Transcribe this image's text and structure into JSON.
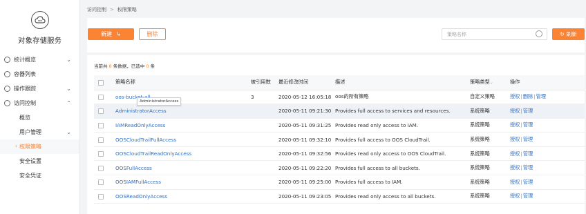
{
  "app": {
    "title": "对象存储服务"
  },
  "sidebar": {
    "items": [
      {
        "label": "统计概览",
        "icon": "chart-icon",
        "chevron": "⌄"
      },
      {
        "label": "容器列表",
        "icon": "bucket-icon",
        "chevron": ""
      },
      {
        "label": "操作跟踪",
        "icon": "track-icon",
        "chevron": "⌄"
      },
      {
        "label": "访问控制",
        "icon": "lock-icon",
        "chevron": "⌃"
      }
    ],
    "subitems": [
      {
        "label": "概览",
        "active": false,
        "chevron": ""
      },
      {
        "label": "用户管理",
        "active": false,
        "chevron": "⌄"
      },
      {
        "label": "权限策略",
        "active": true,
        "chevron": ""
      },
      {
        "label": "安全设置",
        "active": false,
        "chevron": ""
      },
      {
        "label": "安全凭证",
        "active": false,
        "chevron": ""
      }
    ]
  },
  "breadcrumb": {
    "parent": "访问控制",
    "current": "权限策略",
    "separator": ">"
  },
  "toolbar": {
    "new_label": "新建",
    "delete_label": "删除",
    "search_placeholder": "策略名称",
    "refresh_label": "刷新"
  },
  "summary": {
    "prefix": "当前共",
    "total": "8",
    "middle": "条数据，已选中",
    "selected": "0",
    "suffix": "条"
  },
  "table": {
    "headers": [
      "策略名称",
      "被引用数",
      "最近修改时间",
      "描述",
      "策略类型",
      "操作"
    ],
    "rows": [
      {
        "name": "oos-bucket-all",
        "refs": "3",
        "time": "2020-05-12 16:05:18",
        "desc": "oos的所有策略",
        "type": "自定义策略",
        "ops": [
          "授权",
          "删除",
          "管理"
        ]
      },
      {
        "name": "AdministratorAccess",
        "refs": "",
        "time": "2020-05-11 09:21:30",
        "desc": "Provides full access to services and resources.",
        "type": "系统策略",
        "ops": [
          "授权",
          "管理"
        ]
      },
      {
        "name": "IAMReadOnlyAccess",
        "refs": "",
        "time": "2020-05-11 09:31:25",
        "desc": "Provides read only access to IAM.",
        "type": "系统策略",
        "ops": [
          "授权",
          "管理"
        ]
      },
      {
        "name": "OOSCloudTrailFullAccess",
        "refs": "",
        "time": "2020-05-11 09:32:10",
        "desc": "Provides full access to OOS CloudTrail.",
        "type": "系统策略",
        "ops": [
          "授权",
          "管理"
        ]
      },
      {
        "name": "OOSCloudTrailReadOnlyAccess",
        "refs": "",
        "time": "2020-05-11 09:32:56",
        "desc": "Provides read only access to OOS CloudTrail.",
        "type": "系统策略",
        "ops": [
          "授权",
          "管理"
        ]
      },
      {
        "name": "OOSFullAccess",
        "refs": "",
        "time": "2020-05-11 09:22:20",
        "desc": "Provides full access to all buckets.",
        "type": "系统策略",
        "ops": [
          "授权",
          "管理"
        ]
      },
      {
        "name": "OOSIAMFullAccess",
        "refs": "",
        "time": "2020-05-11 09:25:00",
        "desc": "Provides full access to IAM.",
        "type": "系统策略",
        "ops": [
          "授权",
          "管理"
        ]
      },
      {
        "name": "OOSReadOnlyAccess",
        "refs": "",
        "time": "2020-05-11 09:23:05",
        "desc": "Provides read only access to all buckets.",
        "type": "系统策略",
        "ops": [
          "授权",
          "管理"
        ]
      }
    ]
  },
  "tooltip": {
    "text": "AdministratorAccess"
  },
  "colors": {
    "accent": "#fa8334",
    "link": "#2f6fc4"
  }
}
